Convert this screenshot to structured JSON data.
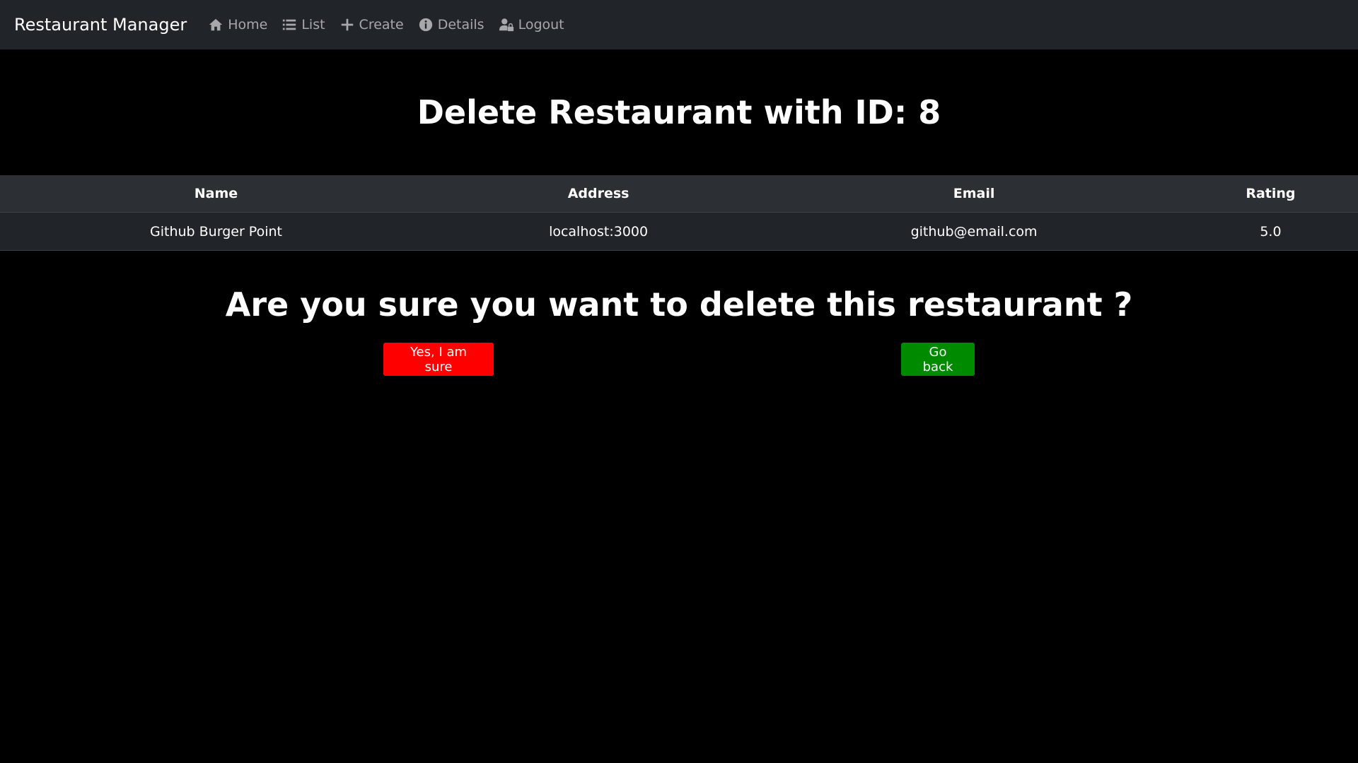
{
  "navbar": {
    "brand": "Restaurant Manager",
    "links": [
      {
        "label": "Home",
        "icon": "home-icon"
      },
      {
        "label": "List",
        "icon": "list-icon"
      },
      {
        "label": "Create",
        "icon": "plus-icon"
      },
      {
        "label": "Details",
        "icon": "info-icon"
      },
      {
        "label": "Logout",
        "icon": "user-lock-icon"
      }
    ]
  },
  "page": {
    "title": "Delete Restaurant with ID: 8",
    "confirm_text": "Are you sure you want to delete this restaurant ?"
  },
  "table": {
    "headers": [
      "Name",
      "Address",
      "Email",
      "Rating"
    ],
    "rows": [
      [
        "Github Burger Point",
        "localhost:3000",
        "github@email.com",
        "5.0"
      ]
    ]
  },
  "actions": {
    "confirm_label": "Yes, I am sure",
    "back_label": "Go back"
  },
  "colors": {
    "navbar_bg": "#212529",
    "danger": "#ff0000",
    "success": "#008a00"
  }
}
